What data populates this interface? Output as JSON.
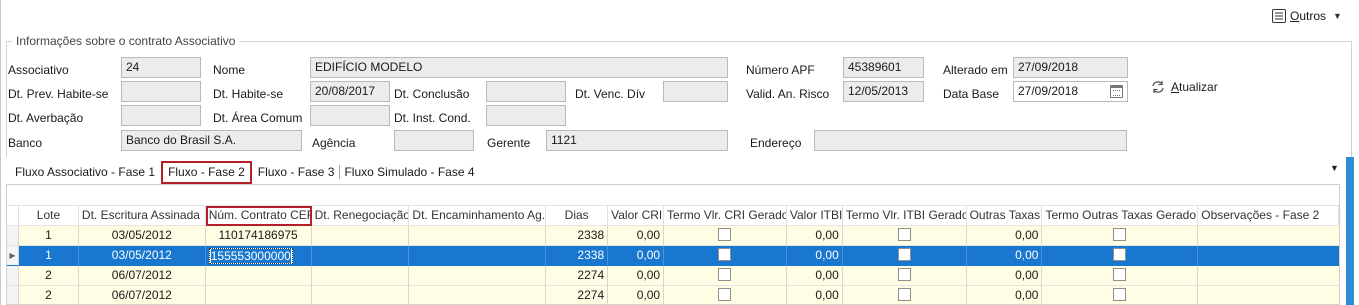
{
  "toolbar": {
    "outros_label": "Outros",
    "outros_underline": "O",
    "outros_rest": "utros"
  },
  "group": {
    "legend": "Informações sobre o contrato Associativo",
    "associativo": {
      "label": "Associativo",
      "value": "24"
    },
    "nome": {
      "label": "Nome",
      "value": "EDIFÍCIO MODELO"
    },
    "numero_apf": {
      "label": "Número APF",
      "value": "45389601"
    },
    "alterado_em": {
      "label": "Alterado em",
      "value": "27/09/2018"
    },
    "dt_prev_habite": {
      "label": "Dt. Prev. Habite-se",
      "value": ""
    },
    "dt_habite": {
      "label": "Dt. Habite-se",
      "value": "20/08/2017"
    },
    "dt_conclusao": {
      "label": "Dt. Conclusão",
      "value": ""
    },
    "dt_venc_div": {
      "label": "Dt. Venc. Dív",
      "value": ""
    },
    "valid_an_risco": {
      "label": "Valid. An. Risco",
      "value": "12/05/2013"
    },
    "data_base": {
      "label": "Data Base",
      "value": "27/09/2018"
    },
    "dt_averbacao": {
      "label": "Dt. Averbação",
      "value": ""
    },
    "dt_area_comum": {
      "label": "Dt. Área Comum",
      "value": ""
    },
    "dt_inst_cond": {
      "label": "Dt. Inst. Cond.",
      "value": ""
    },
    "banco": {
      "label": "Banco",
      "value": "Banco do Brasil S.A."
    },
    "agencia": {
      "label": "Agência",
      "value": ""
    },
    "gerente": {
      "label": "Gerente",
      "value": "1121"
    },
    "endereco": {
      "label": "Endereço",
      "value": ""
    },
    "atualizar": {
      "underline": "A",
      "rest": "tualizar"
    }
  },
  "tabs": [
    {
      "label": "Fluxo Associativo - Fase 1"
    },
    {
      "label": "Fluxo - Fase 2"
    },
    {
      "label": "Fluxo - Fase 3"
    },
    {
      "label": "Fluxo Simulado - Fase 4"
    }
  ],
  "grid": {
    "headers": {
      "lote": "Lote",
      "dt_escritura": "Dt. Escritura Assinada",
      "num_contrato": "Núm. Contrato CEF",
      "dt_reneg": "Dt. Renegociação",
      "dt_encam": "Dt. Encaminhamento Ag.",
      "dias": "Dias",
      "valor_cri": "Valor CRI",
      "termo_cri": "Termo Vlr. CRI Gerado",
      "valor_itbi": "Valor ITBI",
      "termo_itbi": "Termo Vlr. ITBI Gerado",
      "outras_taxas": "Outras Taxas",
      "termo_outras": "Termo Outras Taxas Gerado",
      "obs": "Observações - Fase 2"
    },
    "rows": [
      {
        "lote": "1",
        "dt": "03/05/2012",
        "num": "110174186975",
        "reneg": "",
        "enc": "",
        "dias": "2338",
        "vcri": "0,00",
        "vitbi": "0,00",
        "otx": "0,00",
        "obs": ""
      },
      {
        "lote": "1",
        "dt": "03/05/2012",
        "num": "155553000000",
        "reneg": "",
        "enc": "",
        "dias": "2338",
        "vcri": "0,00",
        "vitbi": "0,00",
        "otx": "0,00",
        "obs": ""
      },
      {
        "lote": "2",
        "dt": "06/07/2012",
        "num": "",
        "reneg": "",
        "enc": "",
        "dias": "2274",
        "vcri": "0,00",
        "vitbi": "0,00",
        "otx": "0,00",
        "obs": ""
      },
      {
        "lote": "2",
        "dt": "06/07/2012",
        "num": "",
        "reneg": "",
        "enc": "",
        "dias": "2274",
        "vcri": "0,00",
        "vitbi": "0,00",
        "otx": "0,00",
        "obs": ""
      }
    ]
  },
  "colors": {
    "selection": "#1977cf",
    "highlight_red": "#b4202a",
    "row_yellow": "#fffde3",
    "accent_blue": "#2b8fd6"
  },
  "icons": {
    "outros": "list-icon",
    "atualizar": "refresh-icon",
    "data_base": "calendar-icon"
  }
}
